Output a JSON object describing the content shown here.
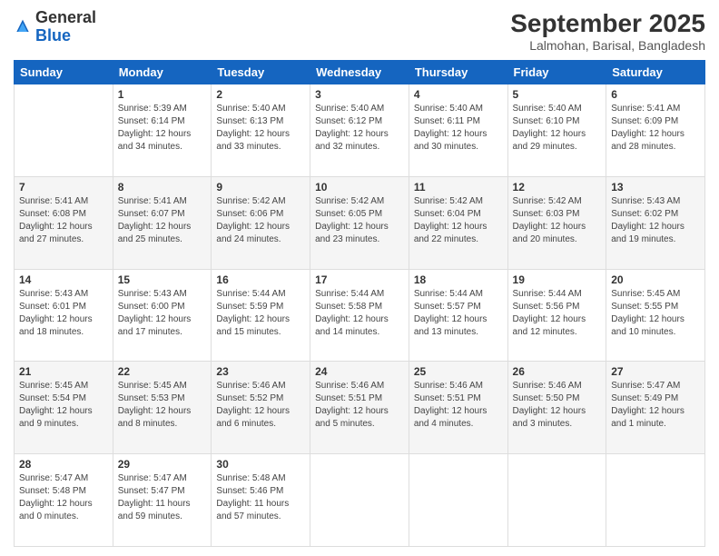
{
  "header": {
    "logo_general": "General",
    "logo_blue": "Blue",
    "month_title": "September 2025",
    "location": "Lalmohan, Barisal, Bangladesh"
  },
  "days_of_week": [
    "Sunday",
    "Monday",
    "Tuesday",
    "Wednesday",
    "Thursday",
    "Friday",
    "Saturday"
  ],
  "weeks": [
    [
      {
        "day": "",
        "info": ""
      },
      {
        "day": "1",
        "info": "Sunrise: 5:39 AM\nSunset: 6:14 PM\nDaylight: 12 hours\nand 34 minutes."
      },
      {
        "day": "2",
        "info": "Sunrise: 5:40 AM\nSunset: 6:13 PM\nDaylight: 12 hours\nand 33 minutes."
      },
      {
        "day": "3",
        "info": "Sunrise: 5:40 AM\nSunset: 6:12 PM\nDaylight: 12 hours\nand 32 minutes."
      },
      {
        "day": "4",
        "info": "Sunrise: 5:40 AM\nSunset: 6:11 PM\nDaylight: 12 hours\nand 30 minutes."
      },
      {
        "day": "5",
        "info": "Sunrise: 5:40 AM\nSunset: 6:10 PM\nDaylight: 12 hours\nand 29 minutes."
      },
      {
        "day": "6",
        "info": "Sunrise: 5:41 AM\nSunset: 6:09 PM\nDaylight: 12 hours\nand 28 minutes."
      }
    ],
    [
      {
        "day": "7",
        "info": "Sunrise: 5:41 AM\nSunset: 6:08 PM\nDaylight: 12 hours\nand 27 minutes."
      },
      {
        "day": "8",
        "info": "Sunrise: 5:41 AM\nSunset: 6:07 PM\nDaylight: 12 hours\nand 25 minutes."
      },
      {
        "day": "9",
        "info": "Sunrise: 5:42 AM\nSunset: 6:06 PM\nDaylight: 12 hours\nand 24 minutes."
      },
      {
        "day": "10",
        "info": "Sunrise: 5:42 AM\nSunset: 6:05 PM\nDaylight: 12 hours\nand 23 minutes."
      },
      {
        "day": "11",
        "info": "Sunrise: 5:42 AM\nSunset: 6:04 PM\nDaylight: 12 hours\nand 22 minutes."
      },
      {
        "day": "12",
        "info": "Sunrise: 5:42 AM\nSunset: 6:03 PM\nDaylight: 12 hours\nand 20 minutes."
      },
      {
        "day": "13",
        "info": "Sunrise: 5:43 AM\nSunset: 6:02 PM\nDaylight: 12 hours\nand 19 minutes."
      }
    ],
    [
      {
        "day": "14",
        "info": "Sunrise: 5:43 AM\nSunset: 6:01 PM\nDaylight: 12 hours\nand 18 minutes."
      },
      {
        "day": "15",
        "info": "Sunrise: 5:43 AM\nSunset: 6:00 PM\nDaylight: 12 hours\nand 17 minutes."
      },
      {
        "day": "16",
        "info": "Sunrise: 5:44 AM\nSunset: 5:59 PM\nDaylight: 12 hours\nand 15 minutes."
      },
      {
        "day": "17",
        "info": "Sunrise: 5:44 AM\nSunset: 5:58 PM\nDaylight: 12 hours\nand 14 minutes."
      },
      {
        "day": "18",
        "info": "Sunrise: 5:44 AM\nSunset: 5:57 PM\nDaylight: 12 hours\nand 13 minutes."
      },
      {
        "day": "19",
        "info": "Sunrise: 5:44 AM\nSunset: 5:56 PM\nDaylight: 12 hours\nand 12 minutes."
      },
      {
        "day": "20",
        "info": "Sunrise: 5:45 AM\nSunset: 5:55 PM\nDaylight: 12 hours\nand 10 minutes."
      }
    ],
    [
      {
        "day": "21",
        "info": "Sunrise: 5:45 AM\nSunset: 5:54 PM\nDaylight: 12 hours\nand 9 minutes."
      },
      {
        "day": "22",
        "info": "Sunrise: 5:45 AM\nSunset: 5:53 PM\nDaylight: 12 hours\nand 8 minutes."
      },
      {
        "day": "23",
        "info": "Sunrise: 5:46 AM\nSunset: 5:52 PM\nDaylight: 12 hours\nand 6 minutes."
      },
      {
        "day": "24",
        "info": "Sunrise: 5:46 AM\nSunset: 5:51 PM\nDaylight: 12 hours\nand 5 minutes."
      },
      {
        "day": "25",
        "info": "Sunrise: 5:46 AM\nSunset: 5:51 PM\nDaylight: 12 hours\nand 4 minutes."
      },
      {
        "day": "26",
        "info": "Sunrise: 5:46 AM\nSunset: 5:50 PM\nDaylight: 12 hours\nand 3 minutes."
      },
      {
        "day": "27",
        "info": "Sunrise: 5:47 AM\nSunset: 5:49 PM\nDaylight: 12 hours\nand 1 minute."
      }
    ],
    [
      {
        "day": "28",
        "info": "Sunrise: 5:47 AM\nSunset: 5:48 PM\nDaylight: 12 hours\nand 0 minutes."
      },
      {
        "day": "29",
        "info": "Sunrise: 5:47 AM\nSunset: 5:47 PM\nDaylight: 11 hours\nand 59 minutes."
      },
      {
        "day": "30",
        "info": "Sunrise: 5:48 AM\nSunset: 5:46 PM\nDaylight: 11 hours\nand 57 minutes."
      },
      {
        "day": "",
        "info": ""
      },
      {
        "day": "",
        "info": ""
      },
      {
        "day": "",
        "info": ""
      },
      {
        "day": "",
        "info": ""
      }
    ]
  ]
}
